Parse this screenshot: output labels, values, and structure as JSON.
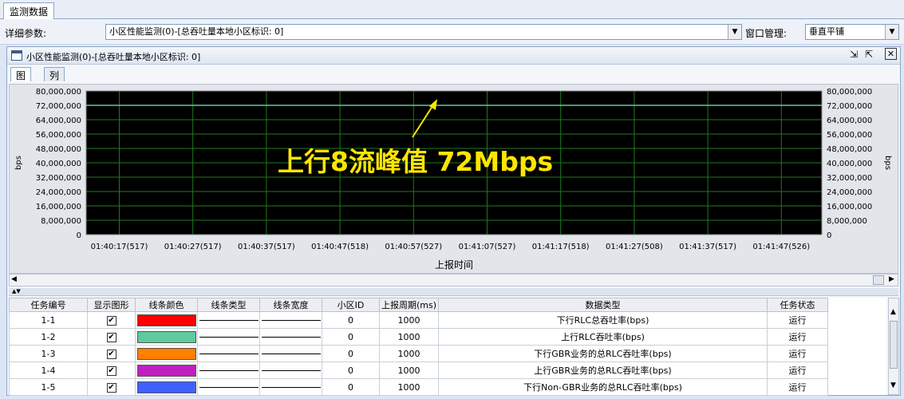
{
  "main_tab": "监测数据",
  "params": {
    "label": "详细参数:",
    "value": "小区性能监测(0)-[总吞吐量本地小区标识: 0]",
    "window_label": "窗口管理:",
    "window_value": "垂直平铺"
  },
  "panel": {
    "title": "小区性能监测(0)-[总吞吐量本地小区标识: 0]",
    "tabs": [
      "图形",
      "列表"
    ]
  },
  "chart_data": {
    "type": "line",
    "ylabel": "bps",
    "ylabel_right": "bps",
    "xlabel": "上报时间",
    "ylim": [
      0,
      80000000
    ],
    "yticks": [
      "80,000,000",
      "72,000,000",
      "64,000,000",
      "56,000,000",
      "48,000,000",
      "40,000,000",
      "32,000,000",
      "24,000,000",
      "16,000,000",
      "8,000,000",
      "0"
    ],
    "xticks": [
      "01:40:17(517)",
      "01:40:27(517)",
      "01:40:37(517)",
      "01:40:47(518)",
      "01:40:57(527)",
      "01:41:07(527)",
      "01:41:17(518)",
      "01:41:27(508)",
      "01:41:37(517)",
      "01:41:47(526)"
    ],
    "series": [
      {
        "color": "#5fc9a0",
        "values": [
          72000000,
          72000000,
          72000000,
          72000000,
          72000000,
          72000000,
          72000000,
          72000000,
          72000000,
          72000000
        ]
      }
    ],
    "annotation": "上行8流峰值 72Mbps",
    "background": "#000000",
    "grid_color": "#1f7a1f"
  },
  "table": {
    "headers": [
      "任务编号",
      "显示图形",
      "线条颜色",
      "线条类型",
      "线条宽度",
      "小区ID",
      "上报周期(ms)",
      "数据类型",
      "任务状态"
    ],
    "rows": [
      {
        "id": "1-1",
        "checked": "✔",
        "color": "#ff0000",
        "cell": "0",
        "period": "1000",
        "type": "下行RLC总吞吐率(bps)",
        "status": "运行"
      },
      {
        "id": "1-2",
        "checked": "✔",
        "color": "#5fc9a0",
        "cell": "0",
        "period": "1000",
        "type": "上行RLC吞吐率(bps)",
        "status": "运行"
      },
      {
        "id": "1-3",
        "checked": "✔",
        "color": "#ff8000",
        "cell": "0",
        "period": "1000",
        "type": "下行GBR业务的总RLC吞吐率(bps)",
        "status": "运行"
      },
      {
        "id": "1-4",
        "checked": "✔",
        "color": "#c020c0",
        "cell": "0",
        "period": "1000",
        "type": "上行GBR业务的总RLC吞吐率(bps)",
        "status": "运行"
      },
      {
        "id": "1-5",
        "checked": "✔",
        "color": "#4060ff",
        "cell": "0",
        "period": "1000",
        "type": "下行Non-GBR业务的总RLC吞吐率(bps)",
        "status": "运行"
      }
    ]
  }
}
